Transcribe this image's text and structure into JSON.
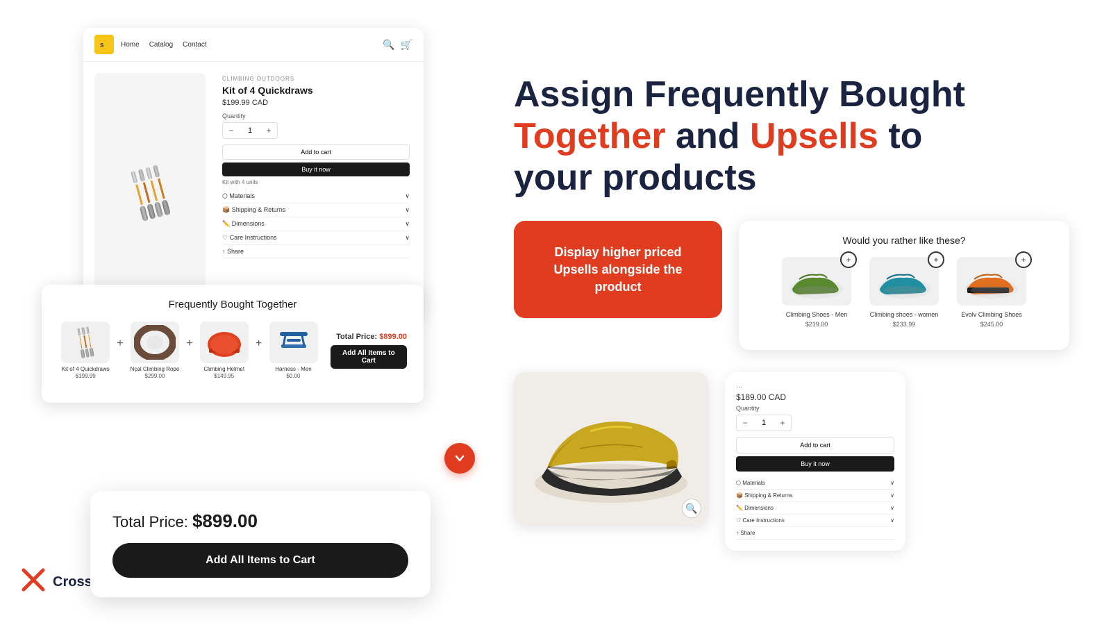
{
  "page": {
    "background": "#ffffff"
  },
  "logo": {
    "brand": "Cross Sell",
    "icon": "XE"
  },
  "headline": {
    "line1": "Assign Frequently Bought",
    "line2_accent": "Together",
    "line2_normal": " and ",
    "line3_accent": "Upsells",
    "line3_normal": " to",
    "line4": "your products"
  },
  "store_mockup": {
    "nav_items": [
      "Home",
      "Catalog",
      "Contact"
    ],
    "brand_label": "CLIMBING OUTDOORS",
    "product_title": "Kit of 4 Quickdraws",
    "product_price": "$199.99 CAD",
    "quantity_label": "Quantity",
    "quantity_value": "1",
    "add_to_cart": "Add to cart",
    "buy_now": "Buy it now",
    "kit_text": "Kit with 4 units",
    "accordion_items": [
      {
        "label": "Materials",
        "icon": "⬡"
      },
      {
        "label": "Shipping & Returns",
        "icon": "📦"
      },
      {
        "label": "Dimensions",
        "icon": "✏️"
      },
      {
        "label": "Care Instructions",
        "icon": "♡"
      },
      {
        "label": "Share",
        "icon": "↑"
      }
    ]
  },
  "fbt_widget": {
    "title": "Frequently Bought Together",
    "products": [
      {
        "name": "Kit of 4 Quickdraws",
        "price": "$199.99"
      },
      {
        "name": "Nçal Climbing Rope",
        "price": "$299.00"
      },
      {
        "name": "Climbing Helmet",
        "price": "$149.95"
      },
      {
        "name": "Harness - Men",
        "price": "$0.00"
      }
    ],
    "total_label": "Total Price:",
    "total_price": "$899.00",
    "add_btn": "Add All Items to Cart"
  },
  "fbt_expanded": {
    "total_label": "Total Price:",
    "total_price": "$899.00",
    "add_btn": "Add All Items to Cart"
  },
  "red_cta": {
    "text": "Display higher priced Upsells alongside the product"
  },
  "upsell_widget": {
    "title": "Would you rather like these?",
    "products": [
      {
        "name": "Climbing Shoes - Men",
        "price": "$219.00"
      },
      {
        "name": "Climbing shoes - women",
        "price": "$233.99"
      },
      {
        "name": "Evolv Climbing Shoes",
        "price": "$245.00"
      }
    ]
  },
  "shoe_product": {
    "price": "$189.00 CAD",
    "quantity_label": "Quantity",
    "quantity_value": "1",
    "add_to_cart": "Add to cart",
    "buy_now": "Buy it now",
    "accordion_items": [
      {
        "label": "Materials"
      },
      {
        "label": "Shipping & Returns"
      },
      {
        "label": "Dimensions"
      },
      {
        "label": "Care Instructions"
      },
      {
        "label": "Share"
      }
    ]
  }
}
